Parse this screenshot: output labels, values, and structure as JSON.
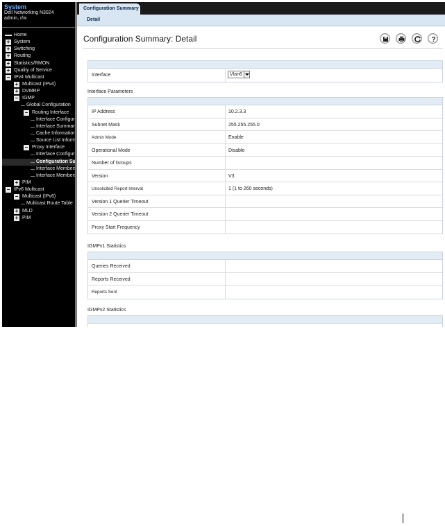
{
  "sidebar": {
    "title": "System",
    "model": "Dell Networking N3024",
    "user": "admin, r/w",
    "tree": [
      {
        "label": "Home",
        "level": 0,
        "icon": "home"
      },
      {
        "label": "System",
        "level": 0,
        "icon": "plus"
      },
      {
        "label": "Switching",
        "level": 0,
        "icon": "plus"
      },
      {
        "label": "Routing",
        "level": 0,
        "icon": "plus"
      },
      {
        "label": "Statistics/RMON",
        "level": 0,
        "icon": "plus"
      },
      {
        "label": "Quality of Service",
        "level": 0,
        "icon": "plus"
      },
      {
        "label": "IPv4 Multicast",
        "level": 0,
        "icon": "minus"
      },
      {
        "label": "Multicast (IPv4)",
        "level": 1,
        "icon": "plus"
      },
      {
        "label": "DVMRP",
        "level": 1,
        "icon": "plus"
      },
      {
        "label": "IGMP",
        "level": 1,
        "icon": "minus"
      },
      {
        "label": "Global Configuration",
        "level": 2,
        "icon": "none"
      },
      {
        "label": "Routing Interface",
        "level": 2,
        "icon": "minus"
      },
      {
        "label": "Interface Configuration",
        "level": 3,
        "icon": "none"
      },
      {
        "label": "Interface Summary",
        "level": 3,
        "icon": "none"
      },
      {
        "label": "Cache Information",
        "level": 3,
        "icon": "none"
      },
      {
        "label": "Source List Information",
        "level": 3,
        "icon": "none"
      },
      {
        "label": "Proxy Interface",
        "level": 2,
        "icon": "minus"
      },
      {
        "label": "Interface Configuration",
        "level": 3,
        "icon": "none"
      },
      {
        "label": "Configuration Summary",
        "level": 3,
        "icon": "none",
        "selected": true
      },
      {
        "label": "Interface Membership",
        "level": 3,
        "icon": "none"
      },
      {
        "label": "Interface Membership",
        "level": 3,
        "icon": "none"
      },
      {
        "label": "PIM",
        "level": 1,
        "icon": "plus"
      },
      {
        "label": "IPv6 Multicast",
        "level": 0,
        "icon": "minus"
      },
      {
        "label": "Multicast (IPv6)",
        "level": 1,
        "icon": "minus"
      },
      {
        "label": "Multicast Route Table",
        "level": 2,
        "icon": "none"
      },
      {
        "label": "MLD",
        "level": 1,
        "icon": "plus"
      },
      {
        "label": "PIM",
        "level": 1,
        "icon": "plus"
      }
    ]
  },
  "tabs": {
    "active": "Configuration Summary",
    "sub": "Detail"
  },
  "page": {
    "title": "Configuration Summary: Detail"
  },
  "toolbar": {
    "icons": [
      "save-icon",
      "print-icon",
      "refresh-icon",
      "help-icon"
    ]
  },
  "interface": {
    "label": "Interface",
    "value": "Vlan6"
  },
  "interface_parameters": {
    "title": "Interface Parameters",
    "rows": [
      {
        "key": "IP Address",
        "value": "10.2.3.3"
      },
      {
        "key": "Subnet Mask",
        "value": "255.255.255.0"
      },
      {
        "key": "Admin Mode",
        "value": "Enable"
      },
      {
        "key": "Operational Mode",
        "value": "Disable"
      },
      {
        "key": "Number of Groups",
        "value": ""
      },
      {
        "key": "Version",
        "value": "V3"
      },
      {
        "key": "Unsolicited Report Interval",
        "value": "1  (1 to 260 seconds)"
      },
      {
        "key": "Version 1 Querier Timeout",
        "value": ""
      },
      {
        "key": "Version 2 Querier Timeout",
        "value": ""
      },
      {
        "key": "Proxy Start Frequency",
        "value": ""
      }
    ]
  },
  "igmpv1": {
    "title": "IGMPv1 Statistics",
    "rows": [
      {
        "key": "Queries Received",
        "value": ""
      },
      {
        "key": "Reports Received",
        "value": ""
      },
      {
        "key": "Reports Sent",
        "value": ""
      }
    ]
  },
  "igmpv2": {
    "title": "IGMPv2 Statistics"
  },
  "colors": {
    "sidebar_bg": "#000000",
    "sidebar_title": "#6fb2ff",
    "tab_bg": "#d7e6f2",
    "table_header": "#e3ecf4"
  }
}
